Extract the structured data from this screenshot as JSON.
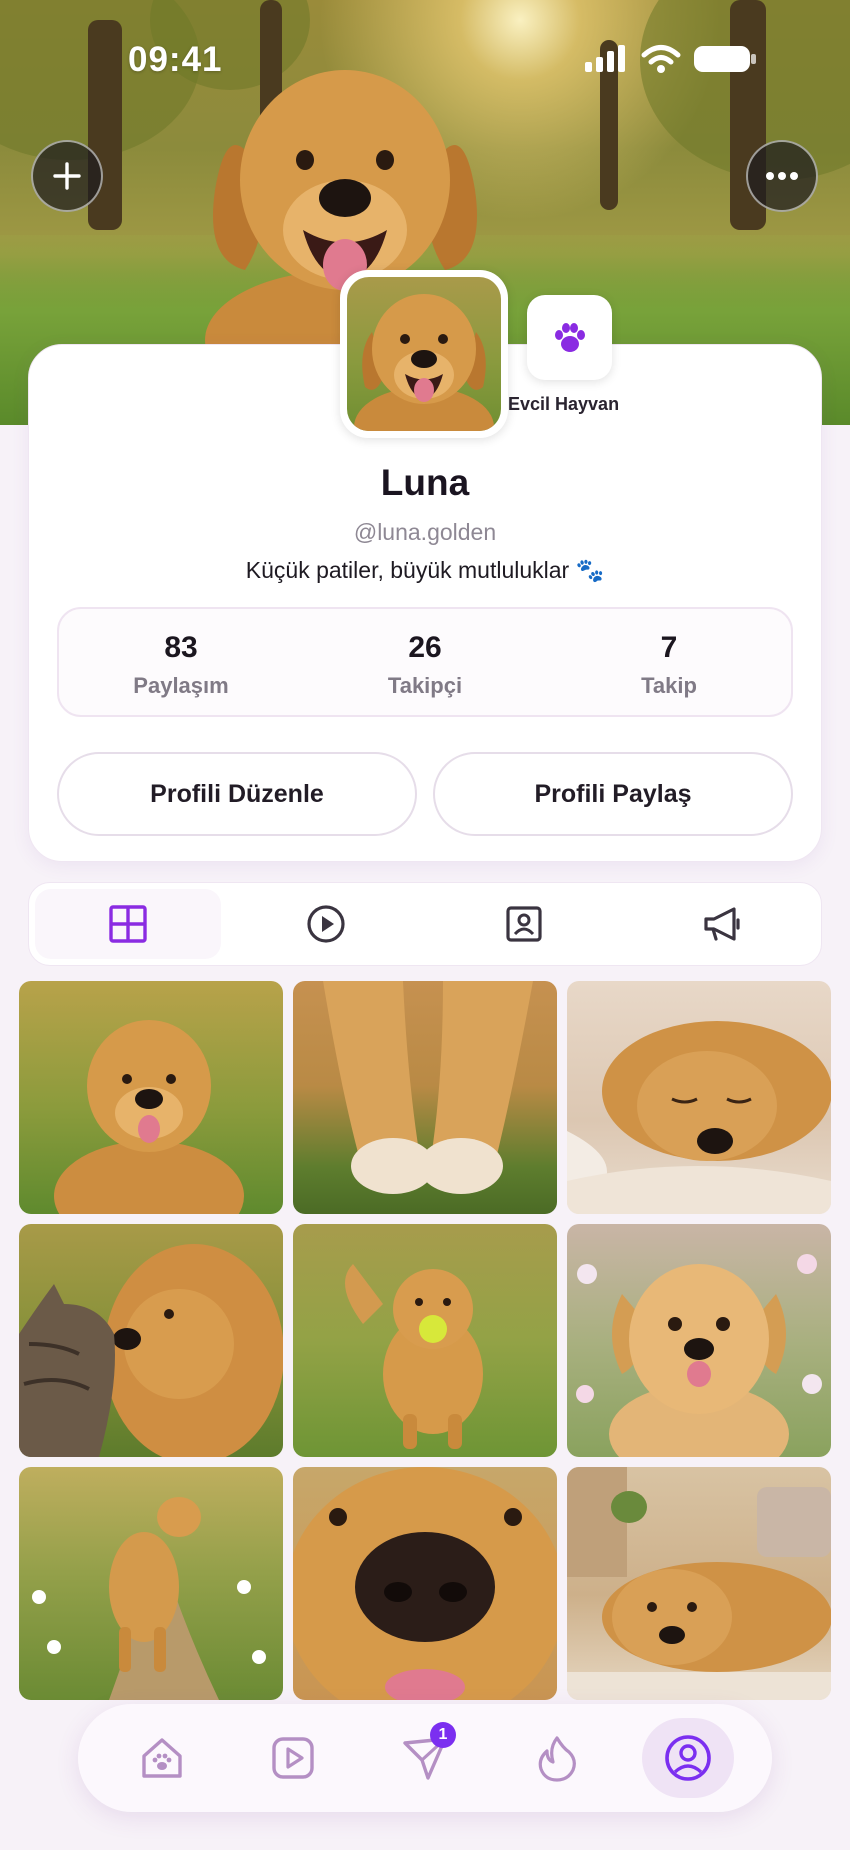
{
  "status_bar": {
    "time": "09:41"
  },
  "profile": {
    "name": "Luna",
    "handle": "@luna.golden",
    "bio": "Küçük patiler, büyük mutluluklar 🐾",
    "category_badge": "Evcil Hayvan"
  },
  "stats": [
    {
      "value": "83",
      "label": "Paylaşım"
    },
    {
      "value": "26",
      "label": "Takipçi"
    },
    {
      "value": "7",
      "label": "Takip"
    }
  ],
  "actions": {
    "edit_label": "Profili Düzenle",
    "share_label": "Profili Paylaş"
  },
  "tabs": [
    {
      "icon": "grid-icon",
      "active": true
    },
    {
      "icon": "play-circle-icon",
      "active": false
    },
    {
      "icon": "tagged-portrait-icon",
      "active": false
    },
    {
      "icon": "megaphone-icon",
      "active": false
    }
  ],
  "nav": {
    "items": [
      "home-paw-icon",
      "play-icon",
      "send-icon",
      "flame-icon",
      "profile-icon"
    ],
    "send_badge": "1"
  },
  "colors": {
    "accent": "#7B2FF0",
    "background": "#F7F2F8",
    "card": "#FFFFFF"
  }
}
